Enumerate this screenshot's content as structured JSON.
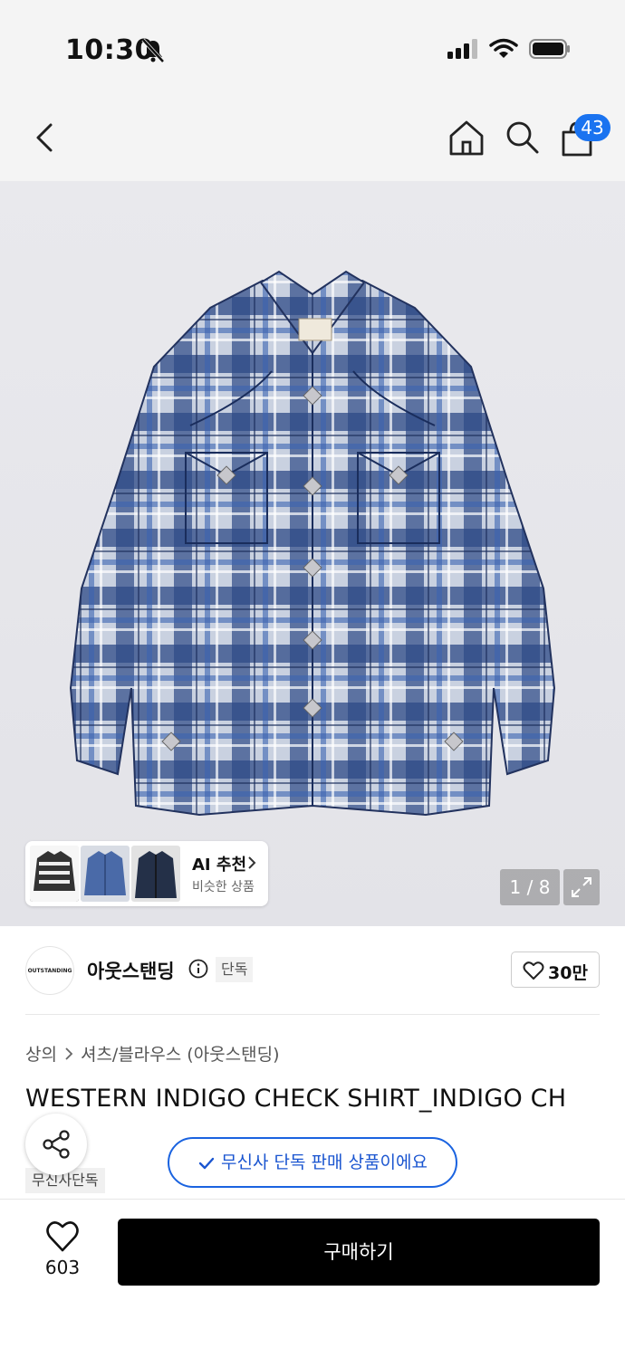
{
  "status_bar": {
    "time": "10:30"
  },
  "nav": {
    "cart_count": "43"
  },
  "gallery": {
    "counter": "1 / 8",
    "ai": {
      "title": "AI 추천",
      "subtitle": "비슷한 상품"
    }
  },
  "brand": {
    "logo_text": "OUTSTANDING",
    "name": "아웃스탠딩",
    "tag": "단독",
    "likes": "30만"
  },
  "breadcrumb": {
    "category": "상의",
    "subcategory": "셔츠/블라우스 (아웃스탠딩)"
  },
  "product": {
    "title": "WESTERN INDIGO CHECK SHIRT_INDIGO CH",
    "exclusive_chip": "무신사단독",
    "exclusive_banner": "무신사 단독 판매 상품이에요"
  },
  "bottom": {
    "like_count": "603",
    "buy_label": "구매하기"
  },
  "colors": {
    "accent_blue": "#1a63e0",
    "badge_blue": "#1a73f0",
    "shirt_indigo": "#2e4a86"
  }
}
